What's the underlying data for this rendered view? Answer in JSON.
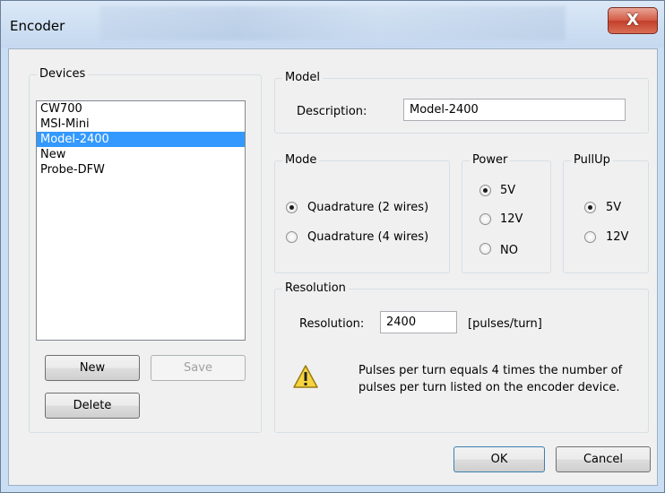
{
  "window": {
    "title": "Encoder",
    "close_glyph": "X"
  },
  "devices": {
    "group_label": "Devices",
    "items": [
      "CW700",
      "MSI-Mini",
      "Model-2400",
      "New",
      "Probe-DFW"
    ],
    "selected_index": 2,
    "new_label": "New",
    "save_label": "Save",
    "delete_label": "Delete"
  },
  "model": {
    "group_label": "Model",
    "description_label": "Description:",
    "description_value": "Model-2400"
  },
  "mode": {
    "group_label": "Mode",
    "options": [
      "Quadrature (2 wires)",
      "Quadrature (4 wires)"
    ],
    "selected_index": 0
  },
  "power": {
    "group_label": "Power",
    "options": [
      "5V",
      "12V",
      "NO"
    ],
    "selected_index": 0
  },
  "pullup": {
    "group_label": "PullUp",
    "options": [
      "5V",
      "12V"
    ],
    "selected_index": 0
  },
  "resolution": {
    "group_label": "Resolution",
    "label": "Resolution:",
    "value": "2400",
    "unit": "[pulses/turn]",
    "warning_text": "Pulses per turn equals 4 times the number of pulses per turn listed on the encoder device."
  },
  "footer": {
    "ok_label": "OK",
    "cancel_label": "Cancel"
  },
  "colors": {
    "selection": "#3399ff",
    "dialog_bg": "#f0f0f0",
    "frame": "#c9ddf3"
  }
}
